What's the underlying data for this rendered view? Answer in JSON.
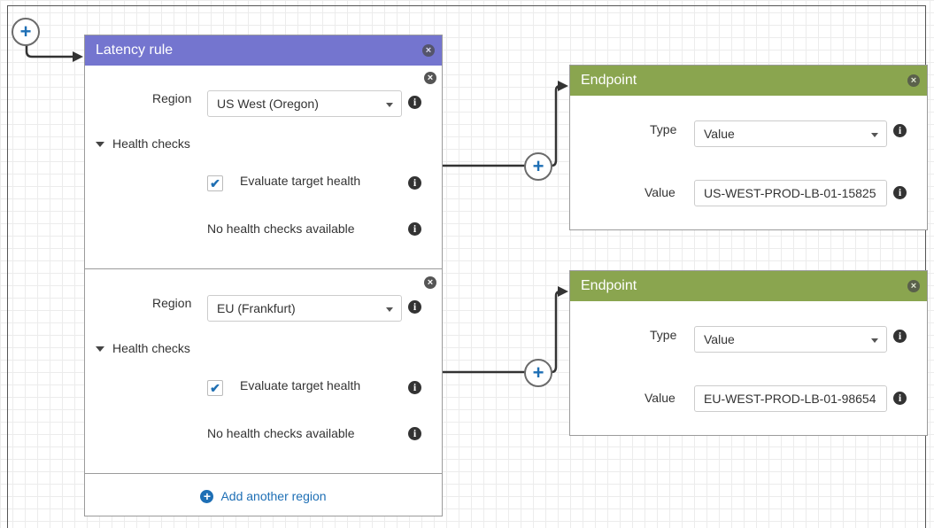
{
  "connectors": {
    "add_symbol": "+"
  },
  "latency_rule": {
    "title": "Latency rule",
    "close_glyph": "×",
    "regions": [
      {
        "region_label": "Region",
        "region_value": "US West (Oregon)",
        "health_checks_label": "Health checks",
        "evaluate_label": "Evaluate target health",
        "evaluate_checked": true,
        "no_health_checks_text": "No health checks available"
      },
      {
        "region_label": "Region",
        "region_value": "EU (Frankfurt)",
        "health_checks_label": "Health checks",
        "evaluate_label": "Evaluate target health",
        "evaluate_checked": true,
        "no_health_checks_text": "No health checks available"
      }
    ],
    "add_region_label": "Add another region"
  },
  "endpoints": [
    {
      "title": "Endpoint",
      "type_label": "Type",
      "type_value": "Value",
      "value_label": "Value",
      "value_value": "US-WEST-PROD-LB-01-15825"
    },
    {
      "title": "Endpoint",
      "type_label": "Type",
      "type_value": "Value",
      "value_label": "Value",
      "value_value": "EU-WEST-PROD-LB-01-98654"
    }
  ],
  "icons": {
    "info": "i",
    "check": "✔",
    "close": "×"
  },
  "colors": {
    "latency_header": "#7475cf",
    "endpoint_header": "#8aa54f",
    "accent_blue": "#1e6fb5"
  }
}
